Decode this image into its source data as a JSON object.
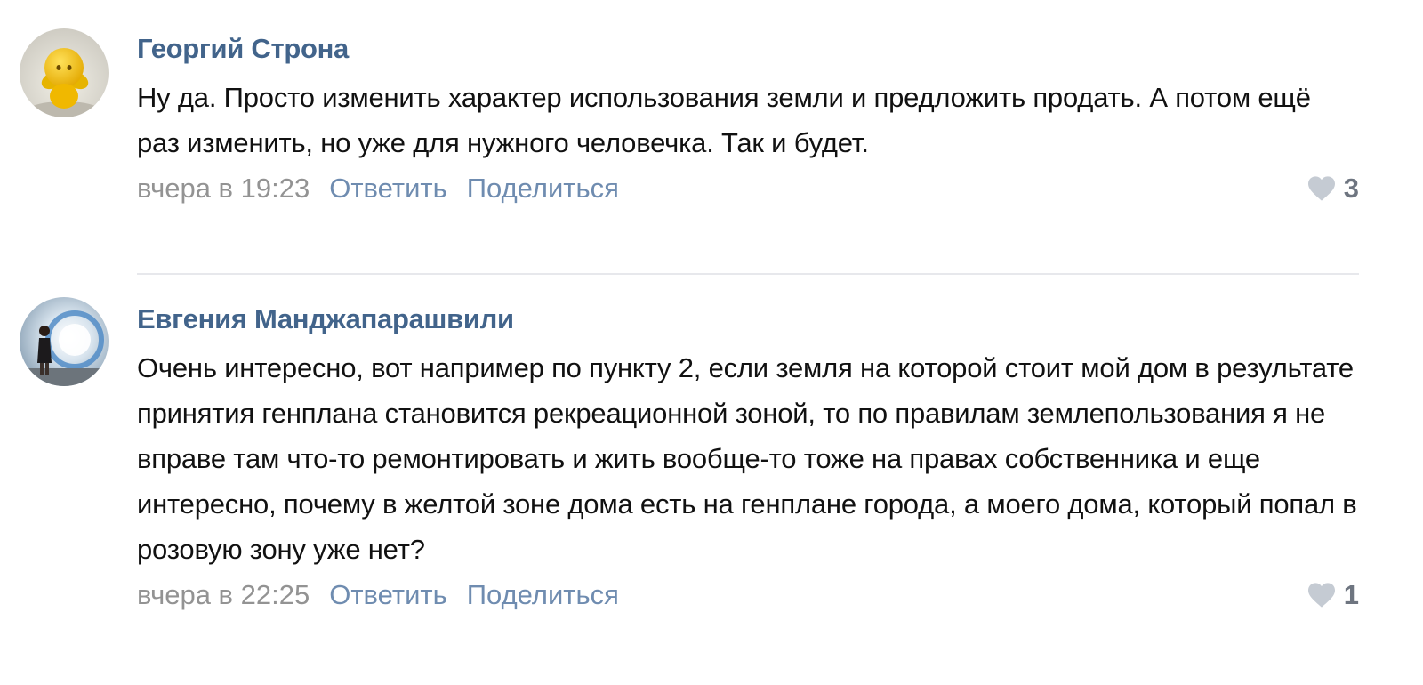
{
  "comments": [
    {
      "author": "Георгий Строна",
      "text": "Ну да. Просто изменить характер использования земли и предложить продать. А потом ещё раз изменить, но уже для нужного человечка. Так и будет.",
      "timestamp": "вчера в 19:23",
      "reply_label": "Ответить",
      "share_label": "Поделиться",
      "likes": "3",
      "avatar_icon": "yellow-smiley-figure-avatar"
    },
    {
      "author": "Евгения Манджапарашвили",
      "text": "Очень интересно, вот например по пункту 2, если земля на которой стоит мой дом в результате принятия генплана становится рекреационной зоной, то по правилам землепользования я не вправе там что-то ремонтировать и жить вообще-то тоже на правах собственника и еще интересно, почему в желтой зоне дома есть на генплане города, а моего дома, который попал в розовую зону уже нет?",
      "timestamp": "вчера в 22:25",
      "reply_label": "Ответить",
      "share_label": "Поделиться",
      "likes": "1",
      "avatar_icon": "woman-standing-photo-avatar"
    }
  ],
  "colors": {
    "author": "#42648b",
    "action": "#6f8cb0",
    "timestamp": "#939393",
    "heart": "#c5cbd3",
    "divider": "#e7e8ec"
  }
}
